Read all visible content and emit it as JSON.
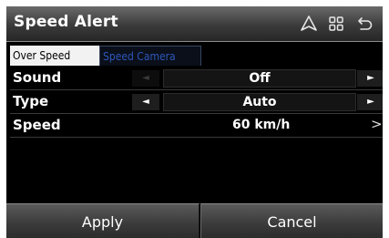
{
  "header": {
    "title": "Speed Alert",
    "icons": [
      "navigation-icon",
      "grid-menu-icon",
      "back-icon"
    ]
  },
  "tabs": [
    {
      "label": "Over Speed",
      "active": true
    },
    {
      "label": "Speed Camera",
      "active": false
    }
  ],
  "settings": {
    "sound": {
      "label": "Sound",
      "value": "Off",
      "left_arrow": "◄",
      "right_arrow": "►"
    },
    "type": {
      "label": "Type",
      "value": "Auto",
      "left_arrow": "◄",
      "right_arrow": "►"
    },
    "speed": {
      "label": "Speed",
      "value": "60 km/h",
      "chevron": ">"
    }
  },
  "footer": {
    "apply_label": "Apply",
    "cancel_label": "Cancel"
  },
  "colors": {
    "background": "#000000",
    "tab_inactive_text": "#2e57b8",
    "text": "#ffffff"
  }
}
